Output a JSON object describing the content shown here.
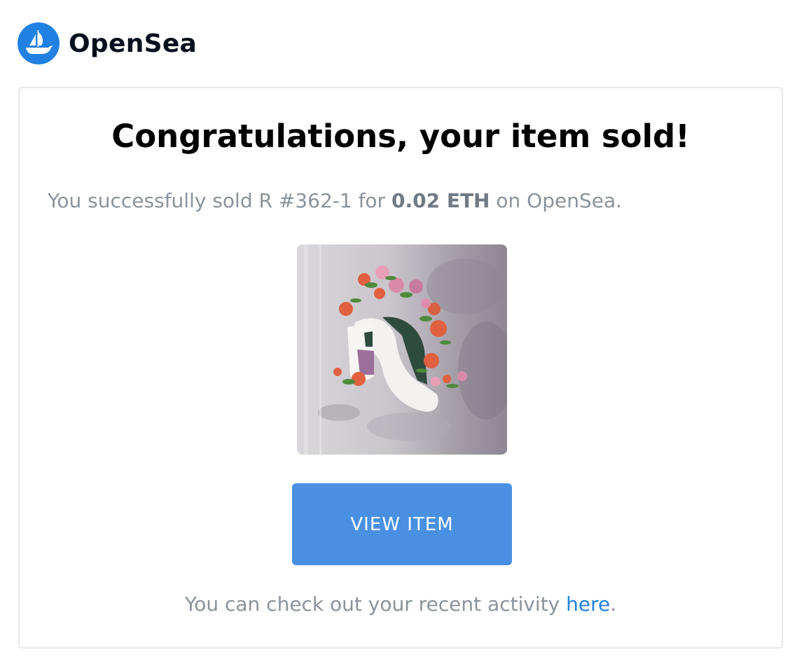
{
  "brand": {
    "name": "OpenSea",
    "logo_icon": "opensea-ship-icon",
    "logo_color": "#2081e2"
  },
  "email": {
    "title": "Congratulations, your item sold!",
    "message_prefix": "You successfully sold R #362-1 for ",
    "price": "0.02 ETH",
    "message_suffix": " on OpenSea.",
    "item_image_alt": "R #362-1",
    "button_label": "VIEW ITEM",
    "button_color": "#4a90e2",
    "footer_prefix": "You can check out your recent activity ",
    "footer_link": "here",
    "footer_suffix": "."
  }
}
